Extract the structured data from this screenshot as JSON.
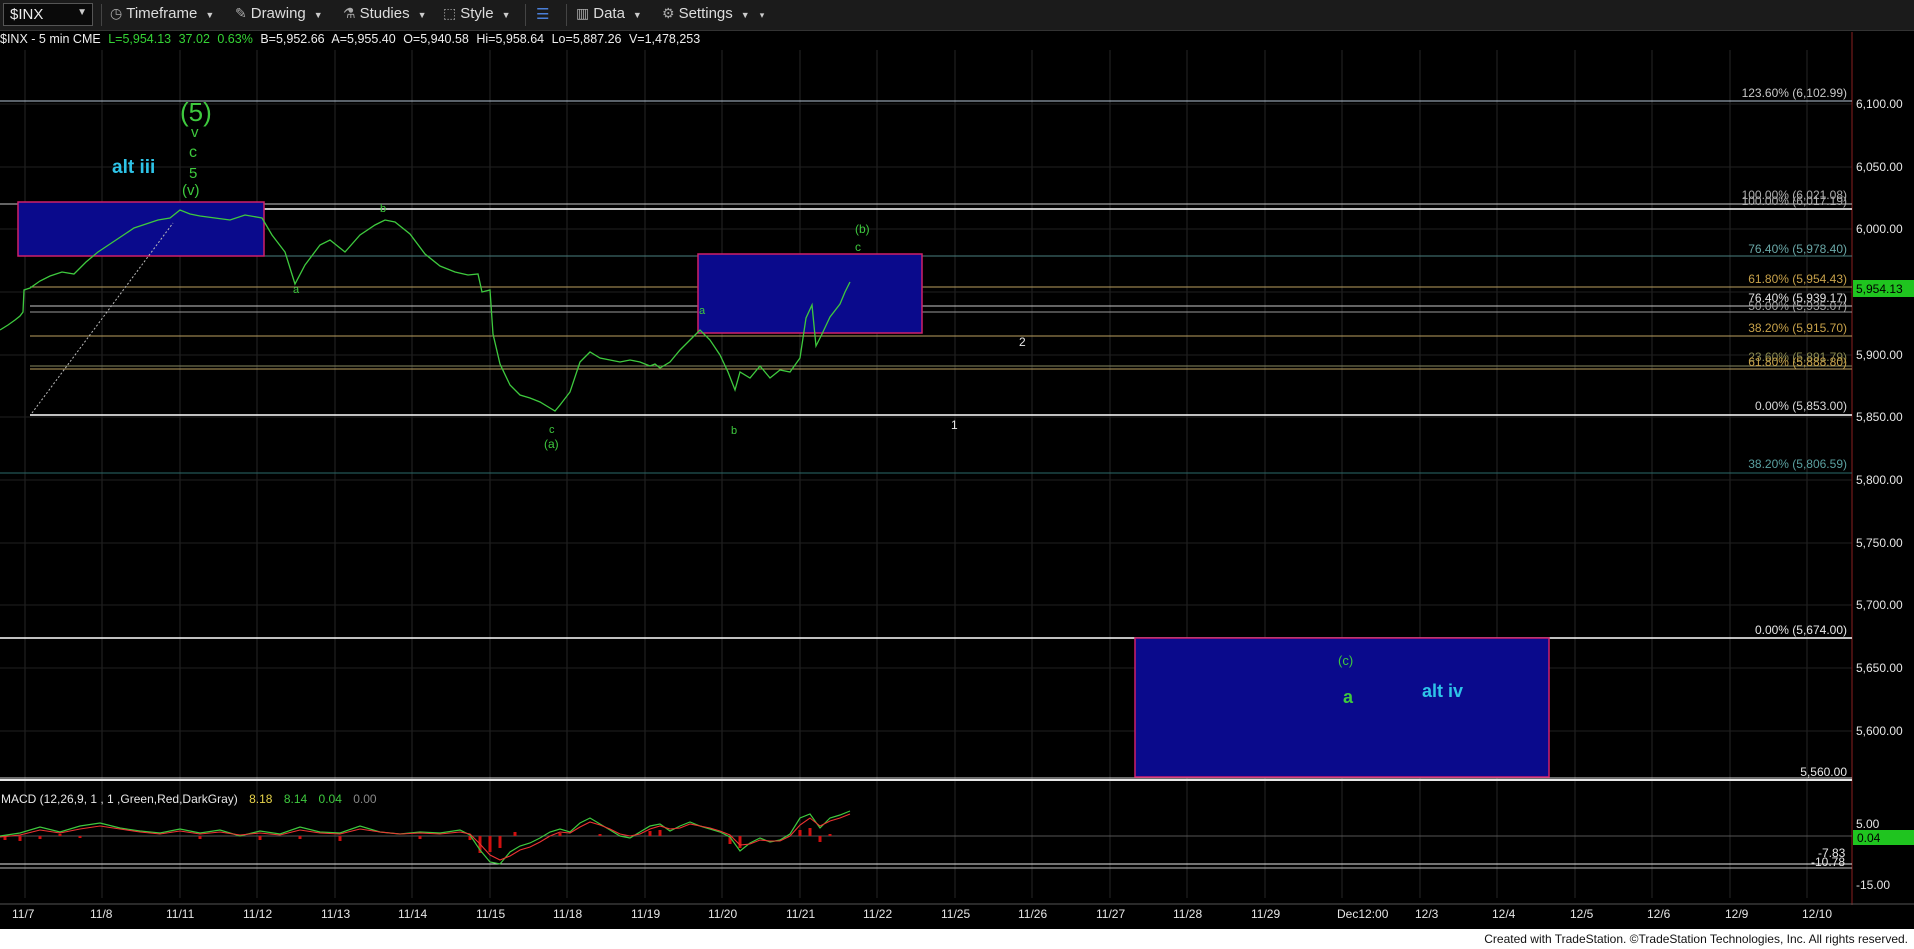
{
  "toolbar": {
    "symbol": "$INX",
    "timeframe": "Timeframe",
    "drawing": "Drawing",
    "studies": "Studies",
    "style": "Style",
    "data": "Data",
    "settings": "Settings"
  },
  "info": {
    "symbol": "$INX - 5 min  CME",
    "last": "L=5,954.13",
    "change": "37.02",
    "pct": "0.63%",
    "bid": "B=5,952.66",
    "ask": "A=5,955.40",
    "open": "O=5,940.58",
    "high": "Hi=5,958.64",
    "low": "Lo=5,887.26",
    "volume": "V=1,478,253"
  },
  "price_axis": {
    "ticks": [
      "6,100.00",
      "6,050.00",
      "6,000.00",
      "5,950.00",
      "5,900.00",
      "5,850.00",
      "5,800.00",
      "5,750.00",
      "5,700.00",
      "5,650.00",
      "5,600.00"
    ],
    "last_badge": "5,954.13"
  },
  "fib_labels": [
    "123.60% (6,102.99)",
    "100.00% (6,021.08)",
    "100.00% (6,017.19)",
    "76.40% (5,978.40)",
    "61.80% (5,954.43)",
    "76.40% (5,939.17)",
    "50.00% (5,935.07)",
    "38.20% (5,915.70)",
    "23.60% (5,891.79)",
    "61.80% (5,888.80)",
    "0.00% (5,853.00)",
    "38.20% (5,806.59)",
    "0.00% (5,674.00)",
    "5,560.00"
  ],
  "wave_labels": {
    "w5": "(5)",
    "v": "v",
    "c": "c",
    "n5": "5",
    "pv": "(v)",
    "alt_iii": "alt iii",
    "b1": "b",
    "a1": "a",
    "c2": "c",
    "pa": "(a)",
    "a2": "a",
    "b2": "b",
    "pb": "(b)",
    "c3": "c",
    "n1": "1",
    "n2": "2",
    "pc": "(c)",
    "a3": "a",
    "alt_iv": "alt iv"
  },
  "macd": {
    "label": "MACD (12,26,9, 1 , 1 ,Green,Red,DarkGray)",
    "v1": "8.18",
    "v2": "8.14",
    "v3": "0.04",
    "v4": "0.00",
    "axis": [
      "5.00",
      "-7.83",
      "-10.78",
      "-15.00"
    ],
    "badge": "0.04"
  },
  "time_axis": [
    "11/7",
    "11/8",
    "11/11",
    "11/12",
    "11/13",
    "11/14",
    "11/15",
    "11/18",
    "11/19",
    "11/20",
    "11/21",
    "11/22",
    "11/25",
    "11/26",
    "11/27",
    "11/28",
    "11/29",
    "Dec12:00",
    "12/3",
    "12/4",
    "12/5",
    "12/6",
    "12/9",
    "12/10"
  ],
  "footer": "Created with TradeStation. ©TradeStation Technologies, Inc. All rights reserved.",
  "colors": {
    "wave_green": "#3ec93e",
    "fib_orange": "#c8a24a",
    "fib_teal": "#5aa0a0",
    "box_fill": "#0a0a8a",
    "box_border": "#d0206a",
    "alt_cyan": "#2ec4e8",
    "last_badge": "#1fc41f"
  }
}
